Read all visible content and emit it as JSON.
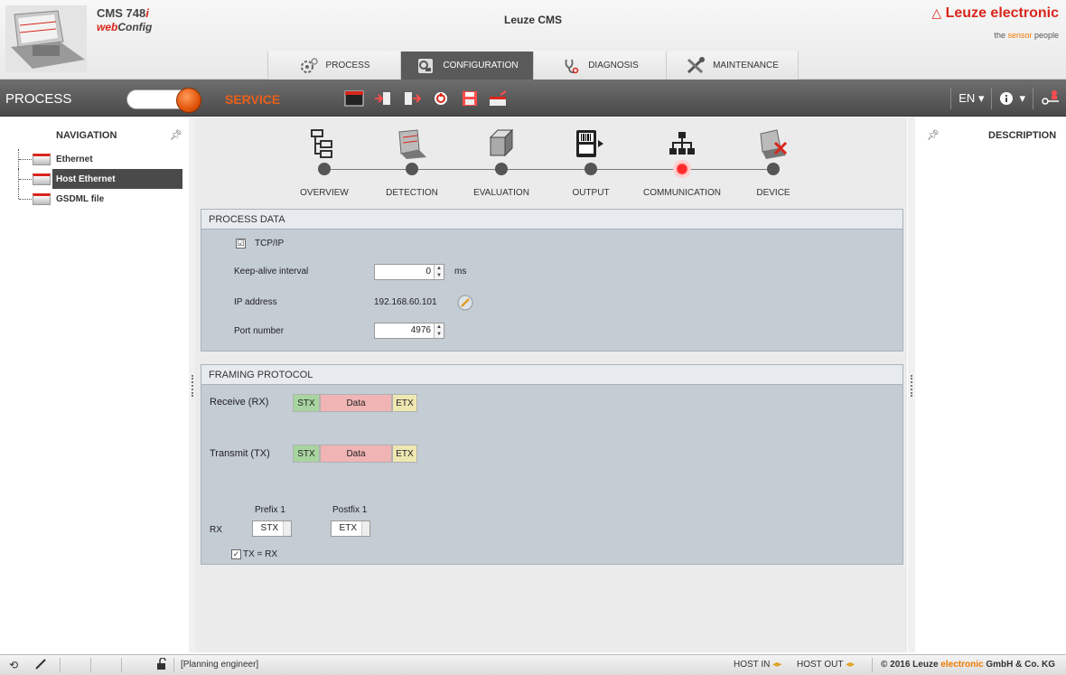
{
  "header": {
    "product_name": "CMS 748",
    "product_name_suffix": "i",
    "product_sub_a": "web",
    "product_sub_b": "Config",
    "app_title": "Leuze CMS",
    "brand_name": "Leuze electronic",
    "brand_tagline_a": "the ",
    "brand_tagline_b": "sensor",
    "brand_tagline_c": " people"
  },
  "tabs": [
    {
      "label": "PROCESS",
      "icon": "process-gears-icon",
      "active": false
    },
    {
      "label": "CONFIGURATION",
      "icon": "configuration-icon",
      "active": true
    },
    {
      "label": "DIAGNOSIS",
      "icon": "diagnosis-icon",
      "active": false
    },
    {
      "label": "MAINTENANCE",
      "icon": "maintenance-tools-icon",
      "active": false
    }
  ],
  "toolbar": {
    "mode_label": "PROCESS",
    "service_label": "SERVICE",
    "language": "EN",
    "language_caret": "▾",
    "info_caret": "▾"
  },
  "navigation": {
    "title": "NAVIGATION",
    "items": [
      {
        "label": "Ethernet"
      },
      {
        "label": "Host Ethernet",
        "selected": true
      },
      {
        "label": "GSDML file"
      }
    ]
  },
  "steps": [
    {
      "label": "OVERVIEW",
      "icon": "overview-tree-icon"
    },
    {
      "label": "DETECTION",
      "icon": "detection-icon"
    },
    {
      "label": "EVALUATION",
      "icon": "evaluation-cube-icon"
    },
    {
      "label": "OUTPUT",
      "icon": "output-barcode-icon"
    },
    {
      "label": "COMMUNICATION",
      "icon": "communication-network-icon",
      "active": true
    },
    {
      "label": "DEVICE",
      "icon": "device-icon"
    }
  ],
  "process_data": {
    "title": "PROCESS DATA",
    "tcpip_label": "TCP/IP",
    "tcpip_checked": "☑",
    "keepalive_label": "Keep-alive interval",
    "keepalive_value": "0",
    "keepalive_unit": "ms",
    "ip_label": "IP address",
    "ip_value": "192.168.60.101",
    "port_label": "Port number",
    "port_value": "4976"
  },
  "framing": {
    "title": "FRAMING PROTOCOL",
    "rx_label": "Receive (RX)",
    "tx_label": "Transmit (TX)",
    "seg_stx": "STX",
    "seg_data": "Data",
    "seg_etx": "ETX",
    "prefix_label": "Prefix 1",
    "postfix_label": "Postfix 1",
    "rx_short": "RX",
    "prefix_value": "STX",
    "postfix_value": "ETX",
    "txrx_label": "TX = RX"
  },
  "description": {
    "title": "DESCRIPTION"
  },
  "status": {
    "role": "[Planning engineer]",
    "host_in": "HOST IN",
    "host_out": "HOST OUT",
    "copyright_a": "© 2016 Leuze ",
    "copyright_b": "electronic",
    "copyright_c": " GmbH & Co. KG"
  }
}
